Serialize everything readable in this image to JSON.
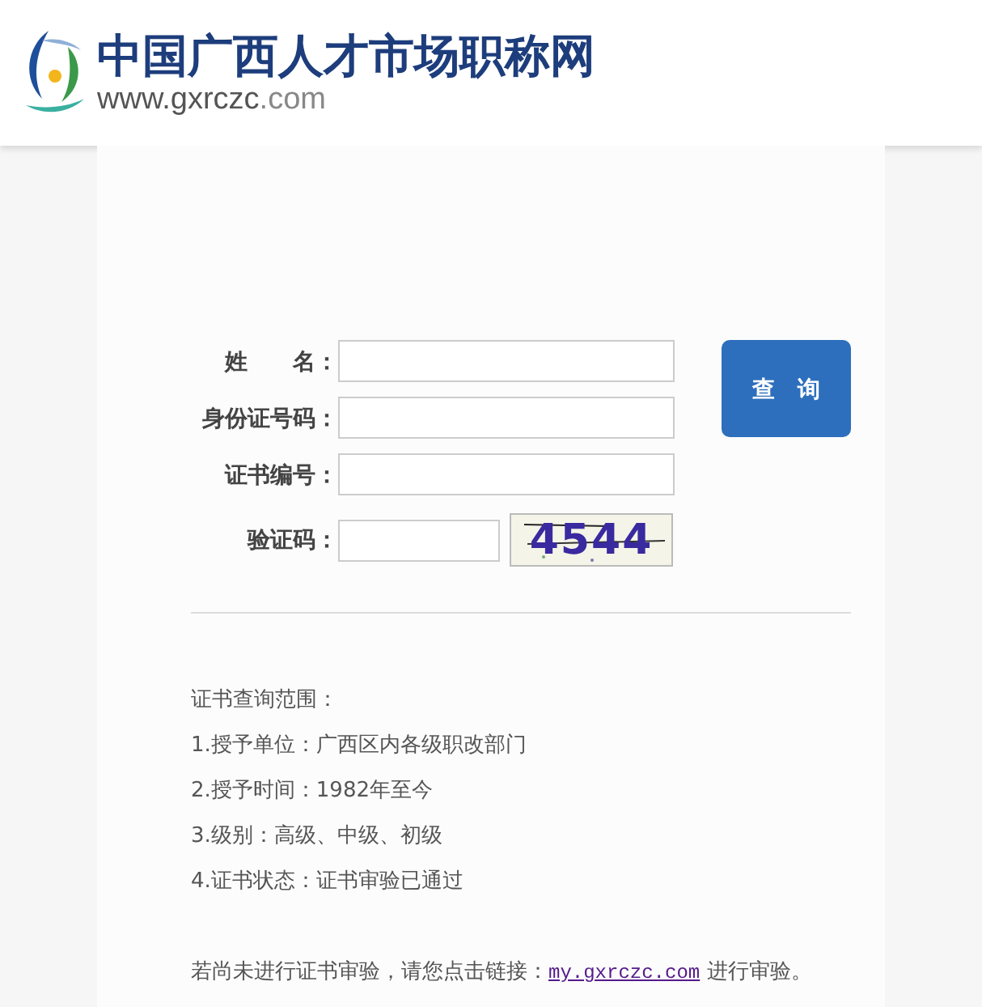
{
  "header": {
    "site_name": "中国广西人才市场职称网",
    "site_url_prefix": "www.gxrczc",
    "site_url_suffix": ".com"
  },
  "form": {
    "fields": [
      {
        "label": "姓　　名：",
        "kind": "text"
      },
      {
        "label": "身份证号码：",
        "kind": "text"
      },
      {
        "label": "证书编号：",
        "kind": "text"
      },
      {
        "label": "验证码：",
        "kind": "captcha",
        "captcha_code": "4544"
      }
    ],
    "submit_button": "查　询"
  },
  "info": {
    "heading": "证书查询范围：",
    "items": [
      "1.授予单位：广西区内各级职改部门",
      "2.授予时间：1982年至今",
      "3.级别：高级、中级、初级",
      "4.证书状态：证书审验已通过"
    ],
    "footer_before": "若尚未进行证书审验，请您点击链接：",
    "footer_link": "my.gxrczc.com",
    "footer_after": " 进行审验。"
  }
}
